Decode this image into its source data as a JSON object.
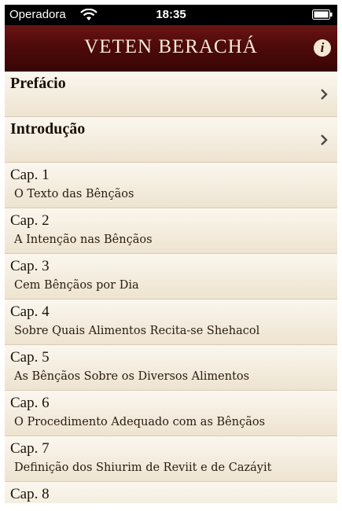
{
  "status": {
    "carrier": "Operadora",
    "time": "18:35"
  },
  "navbar": {
    "title": "VETEN BERACHÁ",
    "info_label": "i"
  },
  "sections": [
    {
      "label": "Prefácio"
    },
    {
      "label": "Introdução"
    }
  ],
  "chapters": [
    {
      "label": "Cap. 1",
      "subtitle": "O Texto das Bênçãos"
    },
    {
      "label": "Cap. 2",
      "subtitle": "A Intenção nas Bênçãos"
    },
    {
      "label": "Cap. 3",
      "subtitle": "Cem Bênçãos por Dia"
    },
    {
      "label": "Cap. 4",
      "subtitle": "Sobre Quais Alimentos Recita-se Shehacol"
    },
    {
      "label": "Cap. 5",
      "subtitle": "As Bênçãos Sobre os Diversos Alimentos"
    },
    {
      "label": "Cap. 6",
      "subtitle": "O Procedimento Adequado com as Bênçãos"
    },
    {
      "label": "Cap. 7",
      "subtitle": "Definição dos Shiurim de Reviit e de Cazáyit"
    },
    {
      "label": "Cap. 8",
      "subtitle": ""
    }
  ]
}
